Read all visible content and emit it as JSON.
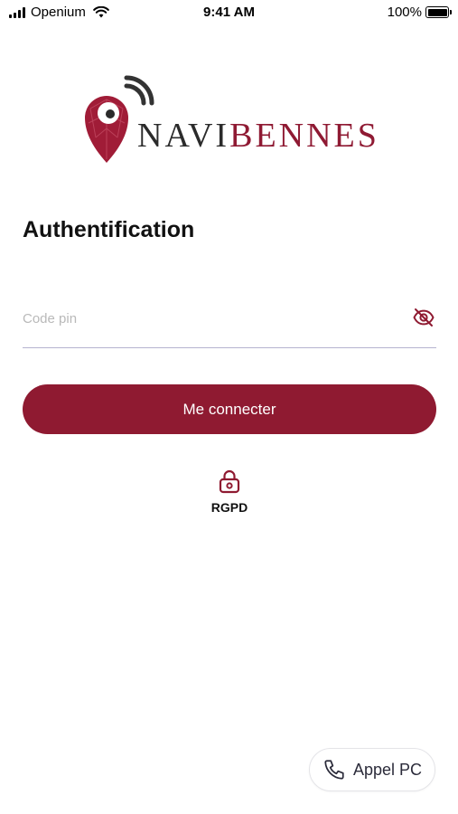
{
  "status_bar": {
    "carrier": "Openium",
    "time": "9:41 AM",
    "battery": "100%"
  },
  "logo": {
    "part1": "NAVI",
    "part2": "BENNES"
  },
  "page": {
    "title": "Authentification"
  },
  "pin": {
    "placeholder": "Code pin",
    "value": ""
  },
  "login": {
    "button_label": "Me connecter"
  },
  "rgpd": {
    "label": "RGPD"
  },
  "call": {
    "label": "Appel PC"
  },
  "colors": {
    "brand": "#8f1a31",
    "field_underline": "#b6b3cf",
    "text": "#111111"
  },
  "icons": {
    "eye_toggle": "eye-off-icon",
    "rgpd": "lock-icon",
    "call": "phone-icon"
  }
}
